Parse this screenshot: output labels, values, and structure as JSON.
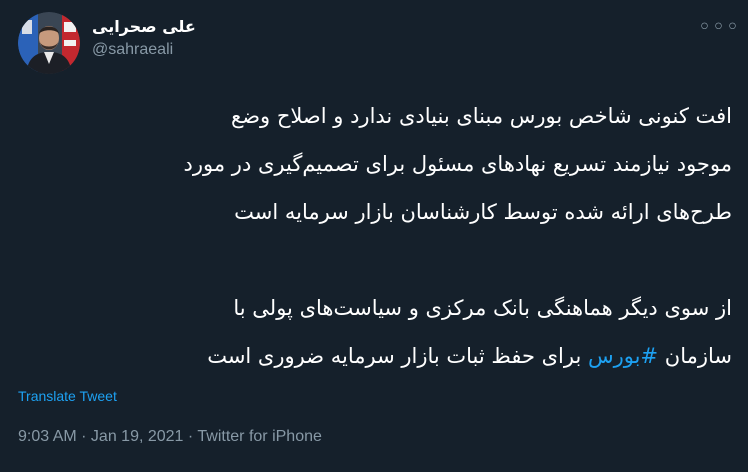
{
  "author": {
    "display_name": "علی صحرایی",
    "handle": "@sahraeali"
  },
  "menu_glyph": "◦◦◦",
  "tweet": {
    "para1_lines": [
      "افت کنونی شاخص بورس مبنای بنیادی ندارد و اصلاح وضع",
      "موجود نیازمند تسریع نهادهای مسئول برای تصمیم‌گیری در مورد",
      "طرح‌های ارائه شده توسط کارشناسان  بازار سرمایه است"
    ],
    "para2_line1": "از سوی دیگر هماهنگی بانک مرکزی و سیاست‌های پولی با",
    "para2_line2_before": "سازمان",
    "hashtag": "#بورس",
    "para2_line2_after": "برای حفظ ثبات بازار سرمایه ضروری است"
  },
  "translate_label": "Translate Tweet",
  "meta": {
    "time": "9:03 AM",
    "separator": " · ",
    "date": "Jan 19, 2021",
    "client": "Twitter for iPhone"
  },
  "colors": {
    "background": "#15202b",
    "text": "#ffffff",
    "secondary": "#8899a6",
    "link": "#1da1f2"
  }
}
